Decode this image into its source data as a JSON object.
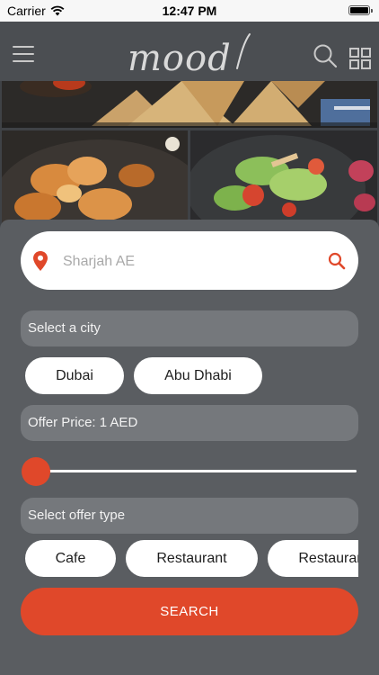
{
  "status_bar": {
    "carrier": "Carrier",
    "time": "12:47 PM"
  },
  "app": {
    "logo_text": "mood"
  },
  "location": {
    "placeholder": "Sharjah AE"
  },
  "city": {
    "prompt": "Select a city",
    "options": [
      "Dubai",
      "Abu Dhabi"
    ]
  },
  "price": {
    "label": "Offer Price: 1 AED",
    "min": 1,
    "slider_fraction": 0
  },
  "offer_type": {
    "prompt": "Select offer type",
    "options": [
      "Cafe",
      "Restaurant",
      "Restaurant"
    ]
  },
  "search_button": {
    "label": "SEARCH"
  },
  "colors": {
    "accent": "#e0482a",
    "panel": "#5a5d61",
    "nav": "#4b4e52"
  }
}
